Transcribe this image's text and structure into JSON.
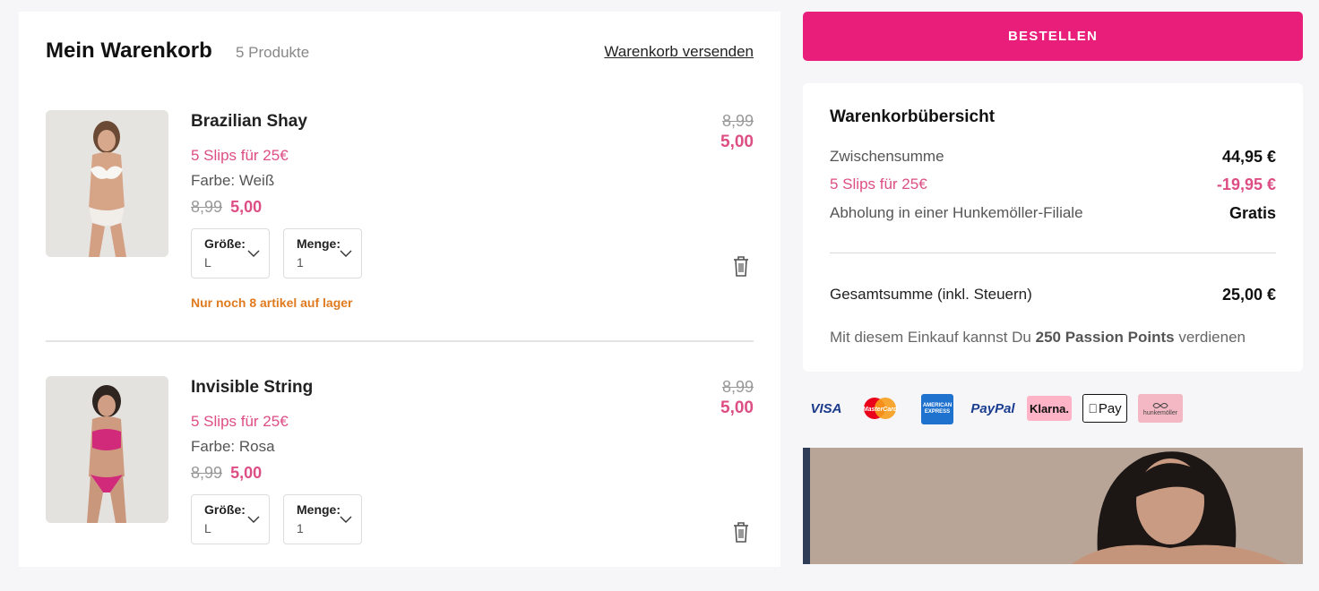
{
  "cart": {
    "title": "Mein Warenkorb",
    "count": "5 Produkte",
    "send_link": "Warenkorb versenden"
  },
  "products": [
    {
      "name": "Brazilian Shay",
      "promo": "5 Slips für 25€",
      "color": "Farbe: Weiß",
      "old_price": "8,99",
      "new_price": "5,00",
      "size_label": "Größe:",
      "size_value": "L",
      "qty_label": "Menge:",
      "qty_value": "1",
      "stock": "Nur noch 8 artikel auf lager"
    },
    {
      "name": "Invisible String",
      "promo": "5 Slips für 25€",
      "color": "Farbe: Rosa",
      "old_price": "8,99",
      "new_price": "5,00",
      "size_label": "Größe:",
      "size_value": "L",
      "qty_label": "Menge:",
      "qty_value": "1"
    }
  ],
  "order_button": "BESTELLEN",
  "summary": {
    "title": "Warenkorbübersicht",
    "subtotal_label": "Zwischensumme",
    "subtotal_value": "44,95 €",
    "discount_label": "5 Slips für 25€",
    "discount_value": "-19,95 €",
    "pickup_label": "Abholung in einer Hunkemöller-Filiale",
    "pickup_value": "Gratis",
    "total_label": "Gesamtsumme (inkl. Steuern)",
    "total_value": "25,00 €",
    "points_prefix": "Mit diesem Einkauf kannst Du",
    "points_value": "250 Passion Points",
    "points_suffix": "verdienen"
  },
  "payments": {
    "visa": "VISA",
    "mastercard": "MasterCard",
    "amex": "AMERICAN EXPRESS",
    "paypal": "PayPal",
    "klarna": "Klarna.",
    "applepay": "Pay",
    "hunkemoller": "hunkemöller"
  },
  "colors": {
    "accent": "#e91e7a",
    "promo": "#dd4e84",
    "stock": "#e07a1f"
  }
}
